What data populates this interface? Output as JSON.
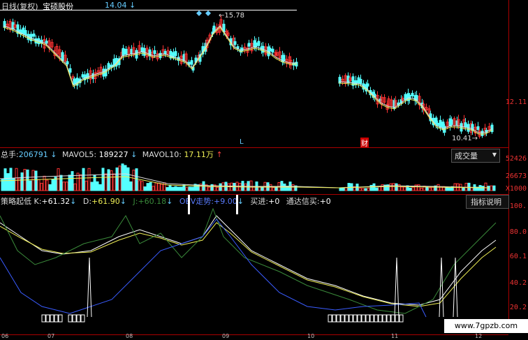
{
  "header": {
    "chart_label": "日线(复权)",
    "stock_name": "宝硕股份",
    "price_marker": "14.04",
    "price_marker_arrow": "↓"
  },
  "price_panel": {
    "high_label": "15.78",
    "low_label": "10.41",
    "axis_value": "12.11",
    "marker_l": "L",
    "marker_cai": "财"
  },
  "volume_panel": {
    "total_label": "总手:",
    "total_value": "206791",
    "total_arrow": "↓",
    "mavol5_label": "MAVOL5:",
    "mavol5_value": "189227",
    "mavol5_arrow": "↓",
    "mavol10_label": "MAVOL10:",
    "mavol10_value": "17.11万",
    "mavol10_arrow": "↑",
    "dropdown_label": "成交量",
    "axis_top": "52426",
    "axis_mid": "26673",
    "axis_unit": "X1000"
  },
  "indicator_panel": {
    "name": "策略起低",
    "k_label": "K:",
    "k_value": "+61.32",
    "k_arrow": "↓",
    "d_label": "D:",
    "d_value": "+61.90",
    "d_arrow": "↓",
    "j_label": "J:",
    "j_value": "+60.18",
    "j_arrow": "↓",
    "obv_label": "OBV走势:",
    "obv_value": "+9.00",
    "obv_arrow": "↓",
    "buy_label": "买进:",
    "buy_value": "+0",
    "signal_label": "通达信买:",
    "signal_value": "+0",
    "explain_button": "指标说明",
    "axis_labels": [
      "100.",
      "80.0",
      "60.1",
      "40.2",
      "20.2"
    ]
  },
  "date_axis": [
    "06",
    "07",
    "08",
    "09",
    "10",
    "11",
    "12"
  ],
  "watermark": "www.7gpzb.com",
  "colors": {
    "up": "#ff3333",
    "down": "#54ffff",
    "k_line": "#ffffff",
    "d_line": "#ffff66",
    "j_line": "#3a8a3a",
    "obv_line": "#3a5cff",
    "axis": "#aa0000"
  }
}
